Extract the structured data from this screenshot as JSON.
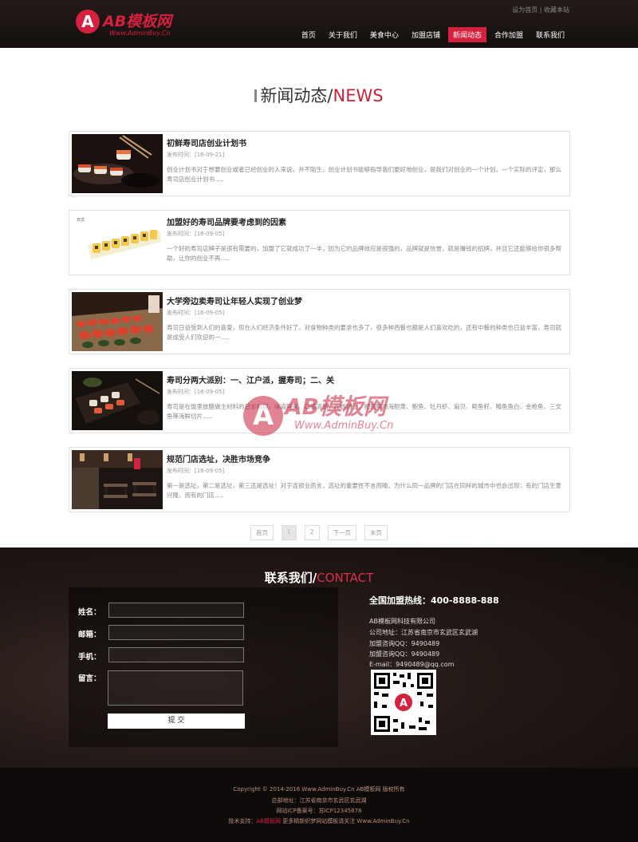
{
  "header": {
    "logo_mark": "A",
    "logo_text": "AB模板网",
    "logo_sub": "Www.AdminBuy.Cn",
    "top_links": [
      "设为首页",
      "收藏本站"
    ],
    "top_separator": "|",
    "nav": [
      "首页",
      "关于我们",
      "美食中心",
      "加盟店铺",
      "新闻动态",
      "合作加盟",
      "联系我们"
    ],
    "active_nav": "新闻动态"
  },
  "section": {
    "title_cn": "新闻动态/",
    "title_en": "NEWS"
  },
  "news": [
    {
      "title": "初鲜寿司店创业计划书",
      "date": "发布时间：[16-09-21]",
      "desc": "创业计划书对于想要创业或者已经创业的人来说，并不陌生，创业计划书能够指导我们更好地创业，是我们对创业的一个计划，一个实际的评定，那么 寿司店创业计划书....."
    },
    {
      "title": "加盟好的寿司品牌要考虑到的因素",
      "date": "发布时间：[16-09-05]",
      "desc": "一个好的寿司店牌子是很有需要的，加盟了它就成功了一半，因为它的品牌效应是很强的，品牌就是信誉，就是赚钱的招牌，并且它还能够给你很多帮助，让你的创业不再....."
    },
    {
      "title": "大学旁边卖寿司让年轻人实现了创业梦",
      "date": "发布时间：[16-09-05]",
      "desc": "寿司日益受到人们的喜爱，现在人们经济条件好了，对食物种类的要求也多了，很多种西餐也都是人们喜欢吃的，还有中餐的种类也日益丰富，寿司就是成受人们欢迎的一....."
    },
    {
      "title": "寿司分两大派别：一、江户派，握寿司；二、关",
      "date": "发布时间：[16-09-05]",
      "desc": "寿司是在饭里放醋做主材料的日本料理，味道鲜美、口感清新，在饭团上，把新鲜的海胆黄、鲍鱼、牡丹虾、扇贝、鲑鱼籽、鳟鱼鱼白、金枪鱼、三文鱼等海鲜切片....."
    },
    {
      "title": "规范门店选址，决胜市场竞争",
      "date": "发布时间：[16-09-05]",
      "desc": "第一是选址，第二是选址，第三还是选址！对于连锁业而言，选址的重要性不言而喻。为什么同一品牌的门店在同样的城市中也会出现：有的门店生意兴隆，而有的门店....."
    }
  ],
  "watermark": {
    "mark": "A",
    "text": "AB模板网",
    "sub": "Www.AdminBuy.Cn"
  },
  "pager": [
    "首页",
    "1",
    "2",
    "下一页",
    "末页"
  ],
  "pager_current": "1",
  "contact": {
    "title_cn": "联系我们/",
    "title_en": "CONTACT",
    "labels": [
      "姓名：",
      "邮箱：",
      "手机：",
      "留言："
    ],
    "submit": "提 交",
    "hotline": "全国加盟热线：400-8888-888",
    "company": "AB模板网科技有限公司",
    "address": "公司地址：江苏省南京市玄武区玄武湖",
    "qq1": "加盟咨询QQ：9490489",
    "qq2": "加盟咨询QQ：9490489",
    "email": "E-mail：9490489@qq.com"
  },
  "footer": {
    "copyright": "Copyright © 2014-2016 Www.AdminBuy.Cn AB模板网 版权所有",
    "address": "总部地址：江苏省南京市玄武区玄武湖",
    "icp": "网站ICP备案号：苏ICP12345678",
    "support_prefix": "技术支持：",
    "support_link": "AB模板网",
    "support_suffix": " 更多精新织梦网站模板请关注 Www.AdminBuy.Cn"
  },
  "colors": {
    "accent": "#d6203f",
    "header_bg": "#1a1412",
    "footer_bg": "#0e0b0a"
  }
}
